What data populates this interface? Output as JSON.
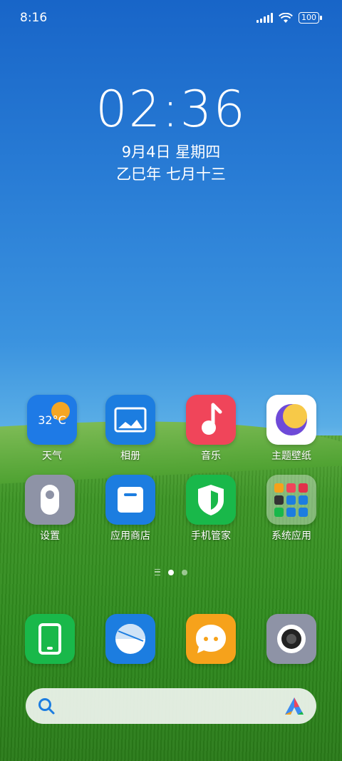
{
  "status_bar": {
    "time": "8:16",
    "battery": "100"
  },
  "lockclock": {
    "time": "02:36",
    "date": "9月4日 星期四",
    "lunar": "乙巳年 七月十三"
  },
  "apps_row1": [
    {
      "label": "天气",
      "icon": "weather-icon",
      "temp": "32°C"
    },
    {
      "label": "相册",
      "icon": "gallery-icon"
    },
    {
      "label": "音乐",
      "icon": "music-icon"
    },
    {
      "label": "主题壁纸",
      "icon": "themes-icon"
    }
  ],
  "apps_row2": [
    {
      "label": "设置",
      "icon": "settings-icon"
    },
    {
      "label": "应用商店",
      "icon": "app-store-icon"
    },
    {
      "label": "手机管家",
      "icon": "security-icon"
    },
    {
      "label": "系统应用",
      "icon": "folder-icon"
    }
  ],
  "dock": [
    {
      "icon": "phone-icon"
    },
    {
      "icon": "browser-icon"
    },
    {
      "icon": "messages-icon"
    },
    {
      "icon": "camera-icon"
    }
  ],
  "colors": {
    "weather": "#1e7ae6",
    "gallery": "#1c7de0",
    "music": "#f0455a",
    "settings": "#8e93a6",
    "store": "#1c7de0",
    "security": "#19b84a",
    "phone": "#19b84a",
    "messages": "#f6a21b",
    "camera": "#8e93a6"
  }
}
